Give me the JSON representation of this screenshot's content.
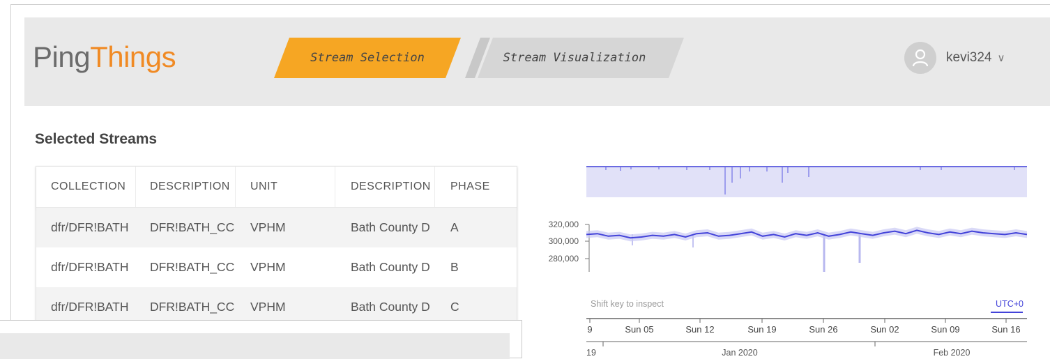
{
  "header": {
    "logo_part1": "Ping",
    "logo_part2": "Things",
    "tabs": [
      {
        "label": "Stream Selection",
        "active": true
      },
      {
        "label": "Stream Visualization",
        "active": false
      }
    ],
    "user": {
      "name": "kevi324"
    }
  },
  "colors": {
    "accent": "#f6a623",
    "logo_gray": "#6b6b6b",
    "logo_orange": "#f08a24",
    "inactive_tab": "#d6d6d6",
    "series": "#4343d9"
  },
  "selected": {
    "title": "Selected Streams",
    "columns": [
      "COLLECTION",
      "DESCRIPTION",
      "UNIT",
      "DESCRIPTION",
      "PHASE"
    ],
    "rows": [
      [
        "dfr/DFR!BATH",
        "DFR!BATH_CC",
        "VPHM",
        "Bath County D",
        "A"
      ],
      [
        "dfr/DFR!BATH",
        "DFR!BATH_CC",
        "VPHM",
        "Bath County D",
        "B"
      ],
      [
        "dfr/DFR!BATH",
        "DFR!BATH_CC",
        "VPHM",
        "Bath County D",
        "C"
      ]
    ]
  },
  "viz": {
    "hint": "Shift key to inspect",
    "timezone": "UTC+0",
    "y_ticks": [
      "320,000",
      "300,000",
      "280,000"
    ],
    "x_ticks_days": [
      "9",
      "Sun 05",
      "Sun 12",
      "Sun 19",
      "Sun 26",
      "Sun 02",
      "Sun 09",
      "Sun 16"
    ],
    "x_ticks_months": [
      "19",
      "Jan 2020",
      "Feb 2020"
    ]
  },
  "chart_data": {
    "type": "line",
    "ylim": [
      270000,
      325000
    ],
    "series": [
      {
        "values": [
          308000,
          309000,
          306000,
          307000,
          304000,
          305000,
          307000,
          306000,
          308000,
          305000,
          309000,
          310000,
          306000,
          307000,
          309000,
          311000,
          306000,
          308000,
          305000,
          309000,
          307000,
          310000,
          306000,
          308000,
          311000,
          309000,
          307000,
          310000,
          312000,
          309000,
          313000,
          310000,
          308000,
          311000,
          309000,
          312000,
          310000,
          309000,
          308000,
          310000,
          308000
        ]
      }
    ]
  }
}
